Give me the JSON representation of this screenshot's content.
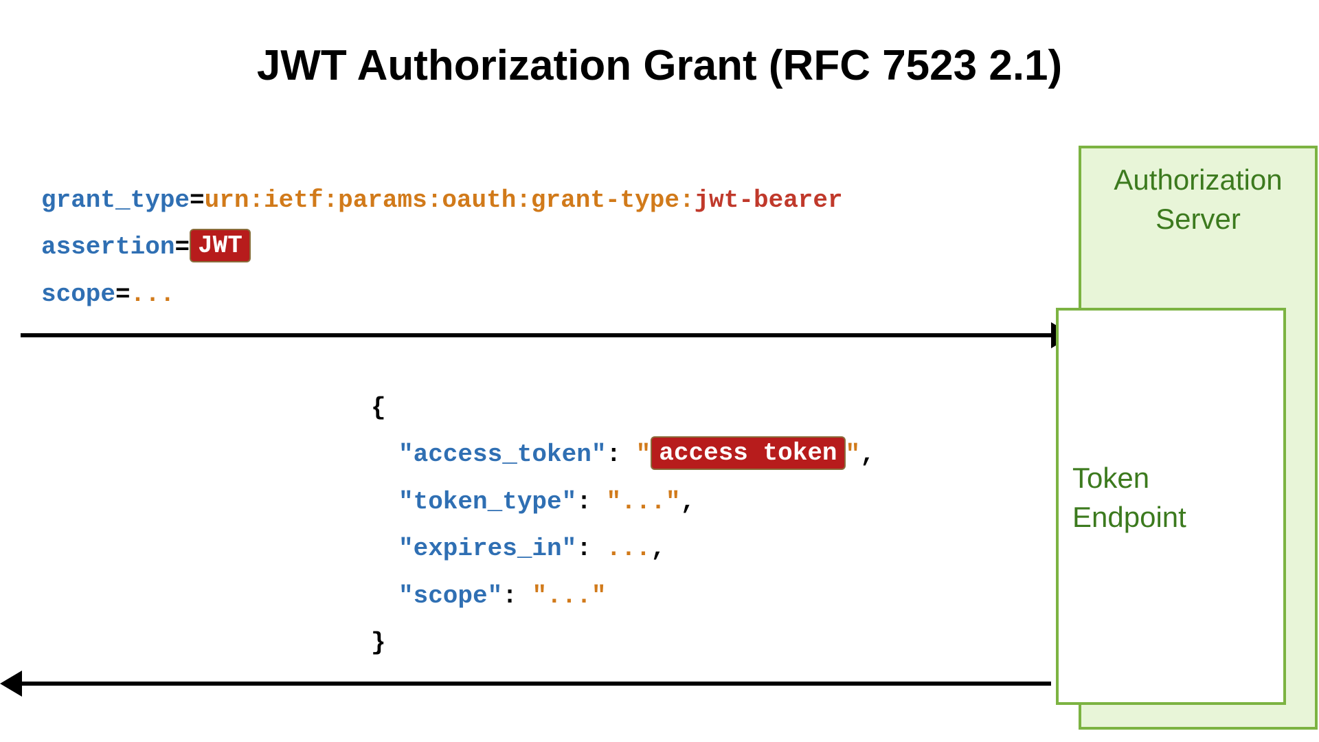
{
  "title": "JWT Authorization Grant (RFC 7523 2.1)",
  "request": {
    "grant_type_key": "grant_type",
    "grant_type_val_pre": "urn:ietf:params:oauth:grant-type:",
    "grant_type_val_suffix": "jwt-bearer",
    "assertion_key": "assertion",
    "assertion_badge": "JWT",
    "scope_key": "scope",
    "scope_val": "..."
  },
  "response": {
    "open": "{",
    "close": "}",
    "access_token_key": "\"access_token\"",
    "access_token_badge": "access token",
    "token_type_key": "\"token_type\"",
    "token_type_val": "\"...\"",
    "expires_in_key": "\"expires_in\"",
    "expires_in_val": "...",
    "scope_key": "\"scope\"",
    "scope_val": "\"...\"",
    "colon": ":",
    "comma": ",",
    "quote": "\""
  },
  "server": {
    "authz_line1": "Authorization",
    "authz_line2": "Server",
    "token_line1": "Token",
    "token_line2": "Endpoint"
  },
  "punct": {
    "eq": "="
  }
}
